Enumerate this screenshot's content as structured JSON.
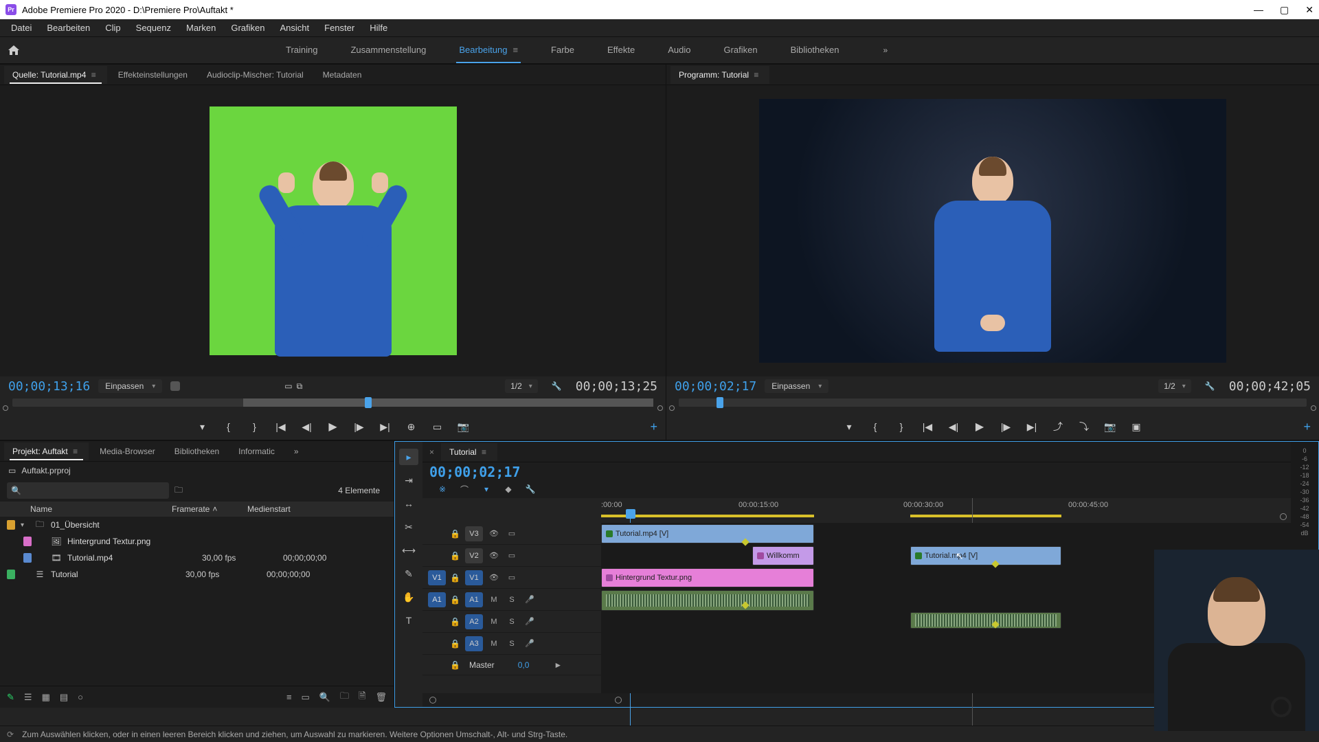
{
  "window": {
    "title": "Adobe Premiere Pro 2020 - D:\\Premiere Pro\\Auftakt *"
  },
  "menu": [
    "Datei",
    "Bearbeiten",
    "Clip",
    "Sequenz",
    "Marken",
    "Grafiken",
    "Ansicht",
    "Fenster",
    "Hilfe"
  ],
  "workspaces": [
    "Training",
    "Zusammenstellung",
    "Bearbeitung",
    "Farbe",
    "Effekte",
    "Audio",
    "Grafiken",
    "Bibliotheken"
  ],
  "workspace_active": "Bearbeitung",
  "source": {
    "tabs": [
      "Quelle: Tutorial.mp4",
      "Effekteinstellungen",
      "Audioclip-Mischer: Tutorial",
      "Metadaten"
    ],
    "tc": "00;00;13;16",
    "fit": "Einpassen",
    "res": "1/2",
    "dur": "00;00;13;25"
  },
  "program": {
    "tab": "Programm: Tutorial",
    "tc": "00;00;02;17",
    "fit": "Einpassen",
    "res": "1/2",
    "dur": "00;00;42;05"
  },
  "project": {
    "tabs": [
      "Projekt: Auftakt",
      "Media-Browser",
      "Bibliotheken",
      "Informatic"
    ],
    "file": "Auftakt.prproj",
    "count": "4 Elemente",
    "headers": {
      "name": "Name",
      "framerate": "Framerate",
      "medienstart": "Medienstart"
    },
    "items": [
      {
        "label": "#d8a030",
        "icon": "folder",
        "name": "01_Übersicht",
        "fr": "",
        "ms": ""
      },
      {
        "label": "#d86ec8",
        "icon": "image",
        "name": "Hintergrund Textur.png",
        "fr": "",
        "ms": ""
      },
      {
        "label": "#5a8ad0",
        "icon": "clip",
        "name": "Tutorial.mp4",
        "fr": "30,00 fps",
        "ms": "00;00;00;00"
      },
      {
        "label": "#3ab060",
        "icon": "sequence",
        "name": "Tutorial",
        "fr": "30,00 fps",
        "ms": "00;00;00;00"
      }
    ]
  },
  "timeline": {
    "tab": "Tutorial",
    "tc": "00;00;02;17",
    "ruler": [
      ":00:00",
      "00:00:15:00",
      "00:00:30:00",
      "00:00:45:00"
    ],
    "tracks": {
      "v": [
        "V3",
        "V2",
        "V1"
      ],
      "a": [
        "A1",
        "A2",
        "A3"
      ],
      "master": "Master",
      "master_val": "0,0"
    },
    "ams": {
      "m": "M",
      "s": "S"
    },
    "clips": {
      "v3": "Tutorial.mp4 [V]",
      "v2a": "Willkomm",
      "v2b": "Tutorial.mp4 [V]",
      "v1": "Hintergrund Textur.png"
    }
  },
  "status": "Zum Auswählen klicken, oder in einen leeren Bereich klicken und ziehen, um Auswahl zu markieren. Weitere Optionen Umschalt-, Alt- und Strg-Taste.",
  "meter_labels": [
    "0",
    "-6",
    "-12",
    "-18",
    "-24",
    "-30",
    "-36",
    "-42",
    "-48",
    "-54",
    "dB"
  ]
}
